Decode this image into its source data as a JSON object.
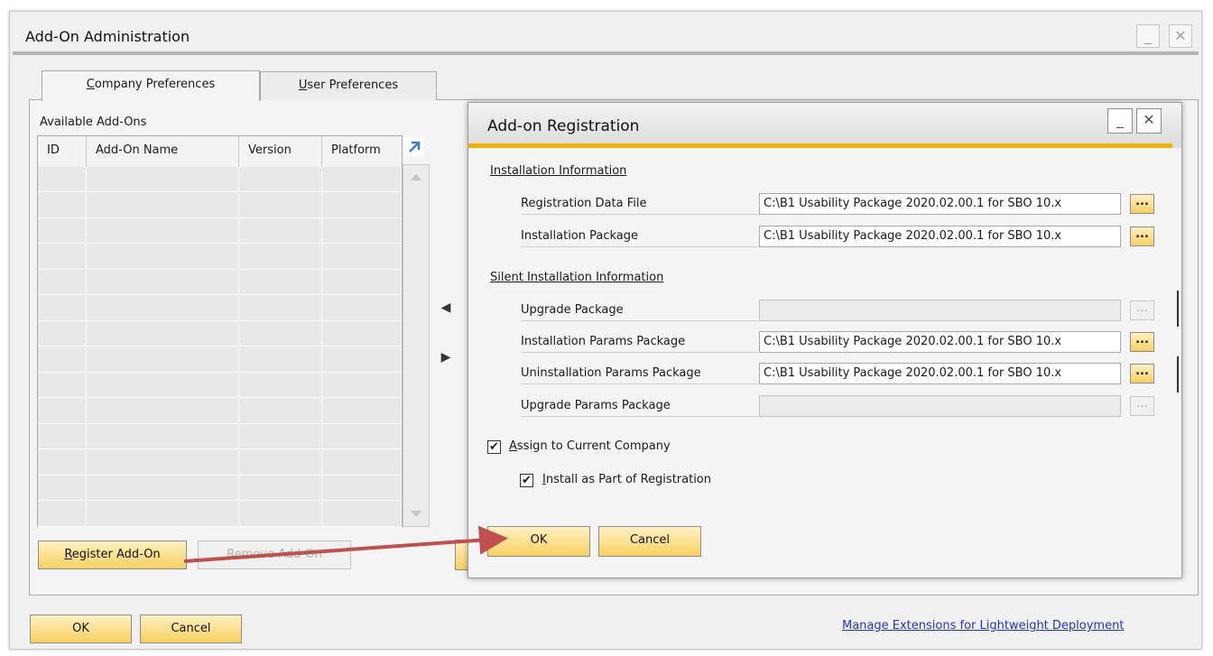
{
  "window": {
    "title": "Add-On Administration",
    "minimize": "_",
    "close": "✕"
  },
  "tabs": [
    {
      "underline": "C",
      "rest": "ompany Preferences"
    },
    {
      "underline": "U",
      "rest": "ser Preferences"
    }
  ],
  "available": {
    "title": "Available Add-Ons",
    "columns": [
      "ID",
      "Add-On Name",
      "Version",
      "Platform"
    ],
    "expand_icon": "expand-arrow-icon"
  },
  "buttons": {
    "register": {
      "underline": "R",
      "rest": "egister Add-On"
    },
    "remove": "Remove Add-On",
    "ok": "OK",
    "cancel": "Cancel",
    "left_arrow": "◀",
    "right_arrow": "▶"
  },
  "link": "Manage Extensions for Lightweight Deployment",
  "dialog": {
    "title": "Add-on Registration",
    "minimize": "_",
    "close": "✕",
    "section1": "Installation Information",
    "registration_data_file": {
      "label": "Registration Data File",
      "value": "C:\\B1 Usability Package 2020.02.00.1 for SBO 10.x"
    },
    "installation_package": {
      "label": "Installation Package",
      "value": "C:\\B1 Usability Package 2020.02.00.1 for SBO 10.x"
    },
    "section2": "Silent Installation Information",
    "upgrade_package": {
      "label": "Upgrade Package",
      "value": ""
    },
    "installation_params": {
      "label": "Installation Params Package",
      "value": "C:\\B1 Usability Package 2020.02.00.1 for SBO 10.x"
    },
    "uninstallation_params": {
      "label": "Uninstallation Params Package",
      "value": "C:\\B1 Usability Package 2020.02.00.1 for SBO 10.x"
    },
    "upgrade_params": {
      "label": "Upgrade Params Package",
      "value": ""
    },
    "browse": "...",
    "assign": {
      "underline": "A",
      "rest": "ssign to Current Company",
      "checked": true
    },
    "install": {
      "underline": "I",
      "rest": "nstall as Part of Registration",
      "checked": true
    },
    "ok": "OK",
    "cancel": "Cancel",
    "check_mark": "✔"
  },
  "annotation_color": "#c0504d"
}
